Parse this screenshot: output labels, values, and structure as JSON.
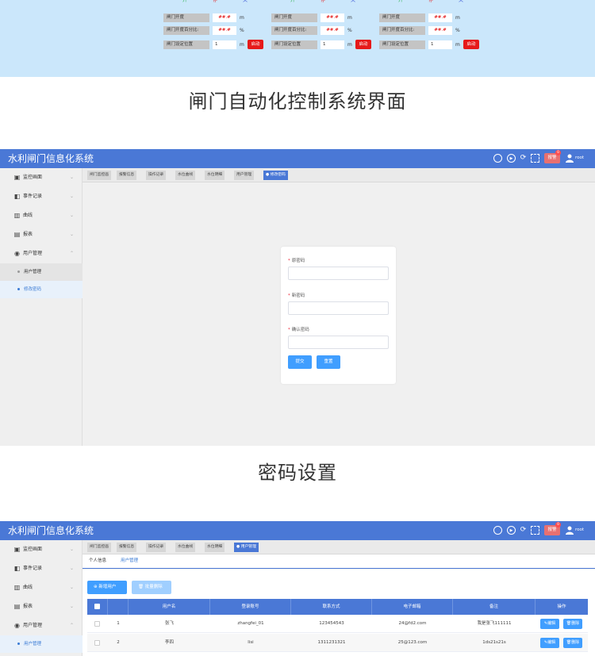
{
  "gate_panel": {
    "columns": [
      {
        "buttons": {
          "open": "开",
          "stop": "停",
          "close": "关"
        },
        "open_label": "闸门开度",
        "open_value": "##.#",
        "open_unit": "m",
        "percent_label": "闸门开度百分比:",
        "percent_value": "##.#",
        "percent_unit": "%",
        "setpos_label": "闸门设定位置",
        "setpos_value": "1",
        "setpos_unit": "m",
        "start_label": "启动"
      },
      {
        "buttons": {
          "open": "开",
          "stop": "停",
          "close": "关"
        },
        "open_label": "闸门开度",
        "open_value": "##.#",
        "open_unit": "m",
        "percent_label": "闸门开度百分比:",
        "percent_value": "##.#",
        "percent_unit": "%",
        "setpos_label": "闸门设定位置",
        "setpos_value": "1",
        "setpos_unit": "m",
        "start_label": "启动"
      },
      {
        "buttons": {
          "open": "开",
          "stop": "停",
          "close": "关"
        },
        "open_label": "闸门开度",
        "open_value": "##.#",
        "open_unit": "m",
        "percent_label": "闸门开度百分比:",
        "percent_value": "##.#",
        "percent_unit": "%",
        "setpos_label": "闸门设定位置",
        "setpos_value": "1",
        "setpos_unit": "m",
        "start_label": "启动"
      }
    ],
    "caption": "闸门自动化控制系统界面"
  },
  "app": {
    "title": "水利闸门信息化系统",
    "alarm_label": "报警",
    "alarm_count": "0",
    "user_name": "root",
    "icons": [
      "search-icon",
      "play-icon",
      "refresh-icon",
      "fullscreen-icon",
      "user-icon"
    ],
    "sidebar": {
      "items": [
        {
          "label": "监控画面",
          "icon": "monitor-icon"
        },
        {
          "label": "事件记录",
          "icon": "event-icon"
        },
        {
          "label": "曲线",
          "icon": "chart-icon"
        },
        {
          "label": "报表",
          "icon": "report-icon"
        },
        {
          "label": "用户管理",
          "icon": "users-icon"
        }
      ],
      "sub_items": [
        "用户管理",
        "修改密码"
      ]
    }
  },
  "password_page": {
    "tabs": [
      "闸门监控画",
      "报警信息",
      "操作记录",
      "水位曲线",
      "水位明细",
      "用户管理",
      "● 修改密码"
    ],
    "form": {
      "old_label": "原密码",
      "new_label": "新密码",
      "confirm_label": "确认密码",
      "submit_label": "提交",
      "reset_label": "重置"
    },
    "caption": "密码设置"
  },
  "user_page": {
    "tabs": [
      "闸门监控画",
      "报警信息",
      "操作记录",
      "水位曲线",
      "水位明细",
      "● 用户管理"
    ],
    "subtabs": [
      "个人信息",
      "用户管理"
    ],
    "add_label": "新增用户",
    "batch_delete_label": "批量删除",
    "table": {
      "headers": [
        "用户名",
        "登录账号",
        "联系方式",
        "电子邮箱",
        "备注",
        "操作"
      ],
      "edit_label": "编辑",
      "delete_label": "删除",
      "rows": [
        {
          "index": "1",
          "name": "张飞",
          "account": "zhangfei_01",
          "phone": "123454543",
          "email": "24@fd2.com",
          "note": "我是张飞111111"
        },
        {
          "index": "2",
          "name": "李四",
          "account": "lisi",
          "phone": "1311231321",
          "email": "25@123.com",
          "note": "1ds21s21s"
        }
      ]
    }
  },
  "colors": {
    "topbar": "#4a78d6",
    "primary_button": "#409eff",
    "danger": "#e61a1a",
    "panel_bg": "#cbe7fb"
  }
}
